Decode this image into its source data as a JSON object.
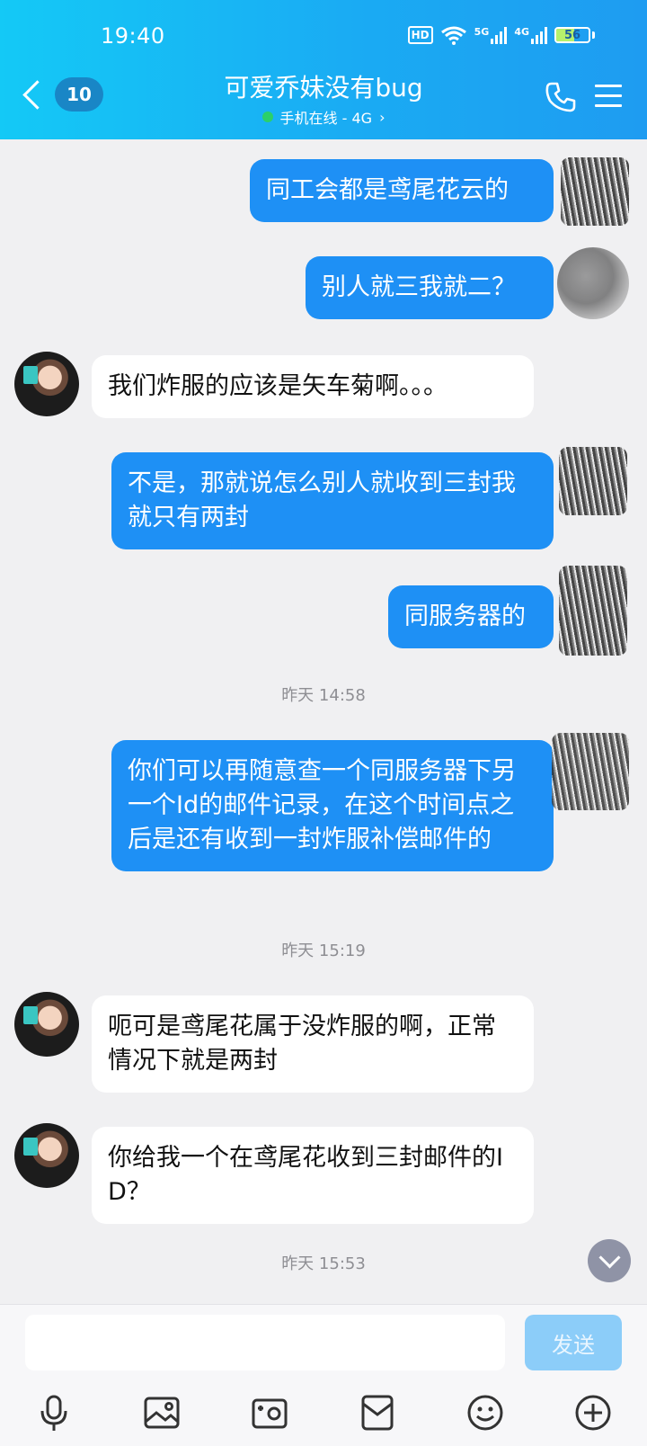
{
  "status_bar": {
    "time": "19:40",
    "hd_label": "HD",
    "net1": "5G",
    "net2": "4G",
    "battery": "56",
    "battery_level": 0.56
  },
  "header": {
    "unread_count": "10",
    "title": "可爱乔妹没有bug",
    "status": "手机在线 - 4G",
    "status_chevron": "›"
  },
  "messages": [
    {
      "from": "self",
      "text": "同工会都是鸢尾花云的"
    },
    {
      "from": "self",
      "text": "别人就三我就二？"
    },
    {
      "from": "other",
      "text": "我们炸服的应该是矢车菊啊。。。"
    },
    {
      "from": "self",
      "text": "不是，那就说怎么别人就收到三封我就只有两封"
    },
    {
      "from": "self",
      "text": "同服务器的"
    },
    {
      "type": "time",
      "text": "昨天 14:58"
    },
    {
      "from": "self",
      "text": "你们可以再随意查一个同服务器下另一个Id的邮件记录，在这个时间点之后是还有收到一封炸服补偿邮件的"
    },
    {
      "type": "time",
      "text": "昨天 15:19"
    },
    {
      "from": "other",
      "text": "呃可是鸢尾花属于没炸服的啊，正常情况下就是两封"
    },
    {
      "from": "other",
      "text": "你给我一个在鸢尾花收到三封邮件的ID？"
    },
    {
      "type": "time",
      "text": "昨天 15:53"
    }
  ],
  "input": {
    "placeholder": "",
    "value": "",
    "send_label": "发送"
  },
  "toolbar": {
    "icons": [
      "microphone-icon",
      "image-icon",
      "camera-icon",
      "red-packet-icon",
      "emoji-icon",
      "plus-icon"
    ]
  },
  "colors": {
    "header_gradient_start": "#14c9f6",
    "header_gradient_end": "#1e9cf1",
    "self_bubble": "#1e90f5",
    "other_bubble": "#ffffff",
    "background": "#f0f0f2",
    "send_button": "#8ccdf9",
    "online_dot": "#2bd06a"
  }
}
